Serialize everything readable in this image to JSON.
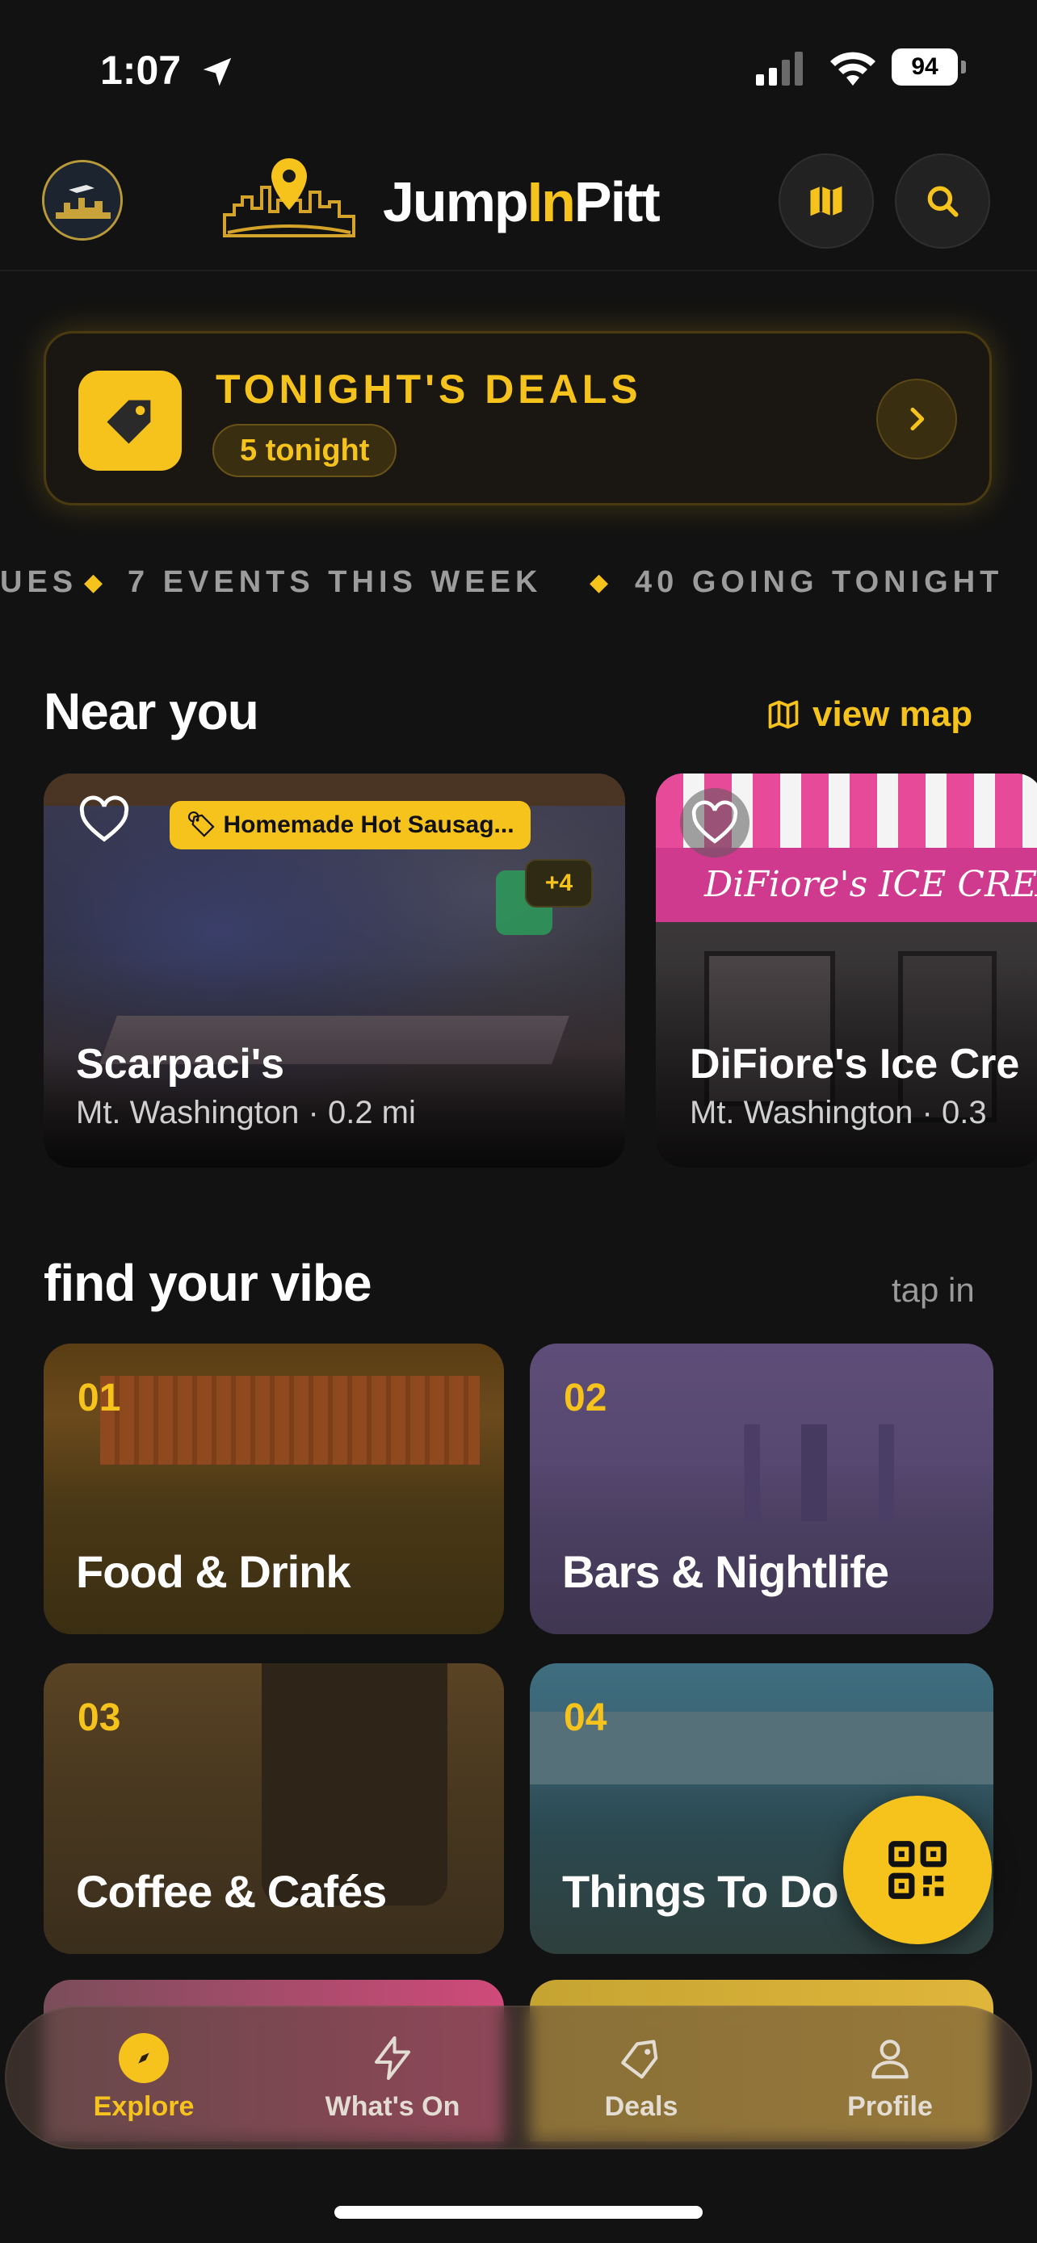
{
  "status_bar": {
    "time": "1:07",
    "battery": "94"
  },
  "header": {
    "brand_part1": "Jump",
    "brand_part2": "In",
    "brand_part3": "Pitt"
  },
  "deals_banner": {
    "title": "TONIGHT'S DEALS",
    "count_label": "5 tonight"
  },
  "ticker": {
    "text_a": "UES",
    "text_b": "7 EVENTS THIS WEEK",
    "text_c": "40 GOING TONIGHT"
  },
  "near_you": {
    "title": "Near you",
    "view_map_label": "view map",
    "places": [
      {
        "name": "Scarpaci's",
        "meta": "Mt. Washington · 0.2 mi",
        "deal": "Homemade Hot Sausag...",
        "extra_deals": "+4"
      },
      {
        "name": "DiFiore's Ice Cre",
        "meta": "Mt. Washington · 0.3",
        "signage": "DiFiore's ICE CREAM"
      }
    ]
  },
  "vibes": {
    "title": "find your vibe",
    "hint": "tap in",
    "items": [
      {
        "num": "01",
        "label": "Food & Drink"
      },
      {
        "num": "02",
        "label": "Bars & Nightlife"
      },
      {
        "num": "03",
        "label": "Coffee & Cafés"
      },
      {
        "num": "04",
        "label": "Things To Do"
      }
    ]
  },
  "tab_bar": {
    "tabs": [
      {
        "label": "Explore",
        "icon": "compass-icon",
        "active": true
      },
      {
        "label": "What's On",
        "icon": "lightning-icon",
        "active": false
      },
      {
        "label": "Deals",
        "icon": "tag-icon",
        "active": false
      },
      {
        "label": "Profile",
        "icon": "person-icon",
        "active": false
      }
    ]
  },
  "colors": {
    "accent": "#f6c21c",
    "background": "#121212"
  }
}
